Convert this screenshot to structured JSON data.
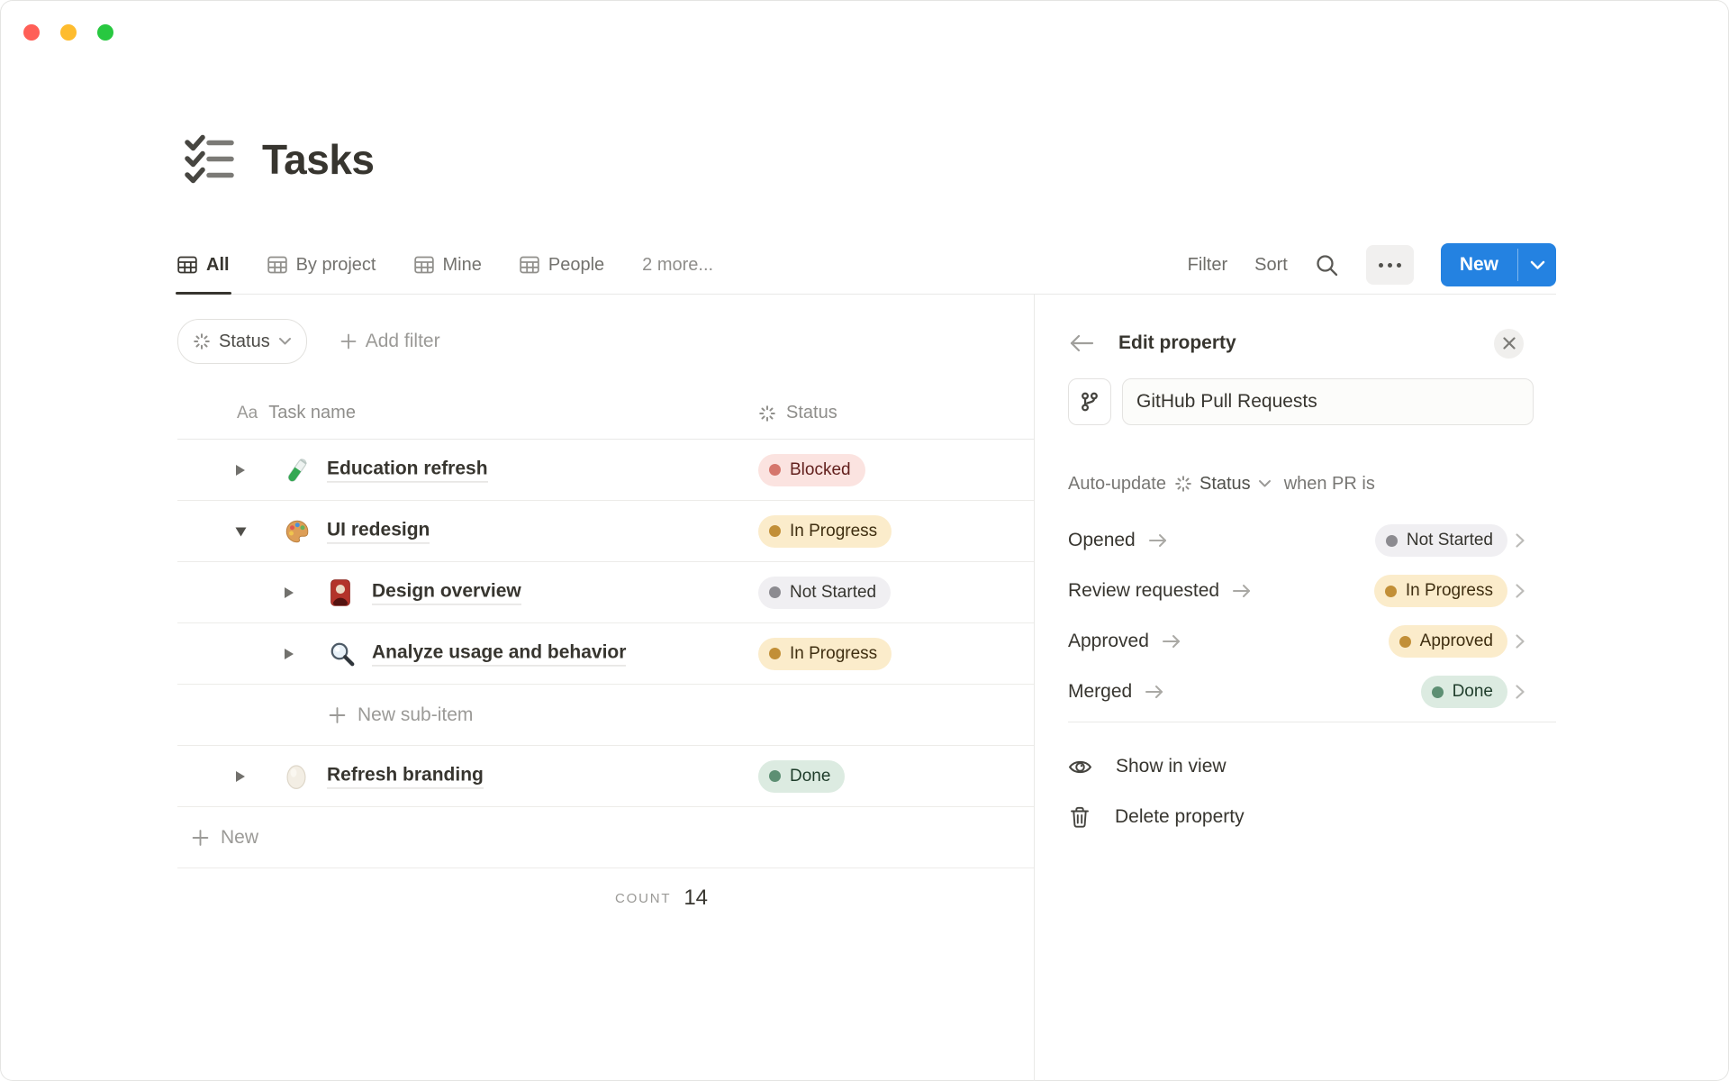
{
  "page": {
    "title": "Tasks"
  },
  "tabs": {
    "items": [
      {
        "label": "All",
        "active": true
      },
      {
        "label": "By project",
        "active": false
      },
      {
        "label": "Mine",
        "active": false
      },
      {
        "label": "People",
        "active": false
      }
    ],
    "overflow_label": "2 more..."
  },
  "toolbar": {
    "filter_label": "Filter",
    "sort_label": "Sort",
    "new_label": "New"
  },
  "filter_bar": {
    "status_filter_label": "Status",
    "add_filter_label": "Add filter"
  },
  "table": {
    "columns": [
      {
        "type_glyph": "Aa",
        "label": "Task name"
      },
      {
        "label": "Status"
      }
    ],
    "rows": [
      {
        "name": "Education refresh",
        "icon": "test-tube",
        "status_label": "Blocked",
        "status_color": "red"
      },
      {
        "name": "UI redesign",
        "icon": "palette",
        "status_label": "In Progress",
        "status_color": "yellow"
      },
      {
        "name": "Design overview",
        "icon": "portrait",
        "status_label": "Not Started",
        "status_color": "gray"
      },
      {
        "name": "Analyze usage and behavior",
        "icon": "magnifier",
        "status_label": "In Progress",
        "status_color": "yellow"
      },
      {
        "type": "add-sub-item",
        "label": "New sub-item"
      },
      {
        "name": "Refresh branding",
        "icon": "egg",
        "status_label": "Done",
        "status_color": "green"
      },
      {
        "type": "add-item",
        "label": "New"
      }
    ],
    "count_label": "COUNT",
    "count_value": "14"
  },
  "panel": {
    "title": "Edit property",
    "property_name": "GitHub Pull Requests",
    "auto_update": {
      "prefix": "Auto-update",
      "property": "Status",
      "suffix": "when PR is"
    },
    "mappings": [
      {
        "event": "Opened",
        "status_label": "Not Started",
        "status_color": "gray"
      },
      {
        "event": "Review requested",
        "status_label": "In Progress",
        "status_color": "yellow"
      },
      {
        "event": "Approved",
        "status_label": "Approved",
        "status_color": "yellow"
      },
      {
        "event": "Merged",
        "status_label": "Done",
        "status_color": "green"
      }
    ],
    "actions": [
      {
        "label": "Show in view",
        "icon": "eye"
      },
      {
        "label": "Delete property",
        "icon": "trash"
      }
    ]
  },
  "colors": {
    "accent_blue": "#2482e1",
    "pill_red_bg": "#fbe3e0",
    "pill_red_dot": "#d5766c",
    "pill_red_text": "#63201d",
    "pill_yellow_bg": "#fbeccb",
    "pill_yellow_dot": "#c28f37",
    "pill_yellow_text": "#3f2e10",
    "pill_gray_bg": "#f0eff2",
    "pill_gray_dot": "#8c8b90",
    "pill_gray_text": "#36352f",
    "pill_green_bg": "#dcebe1",
    "pill_green_dot": "#5d8f73",
    "pill_green_text": "#1f3d2b"
  }
}
